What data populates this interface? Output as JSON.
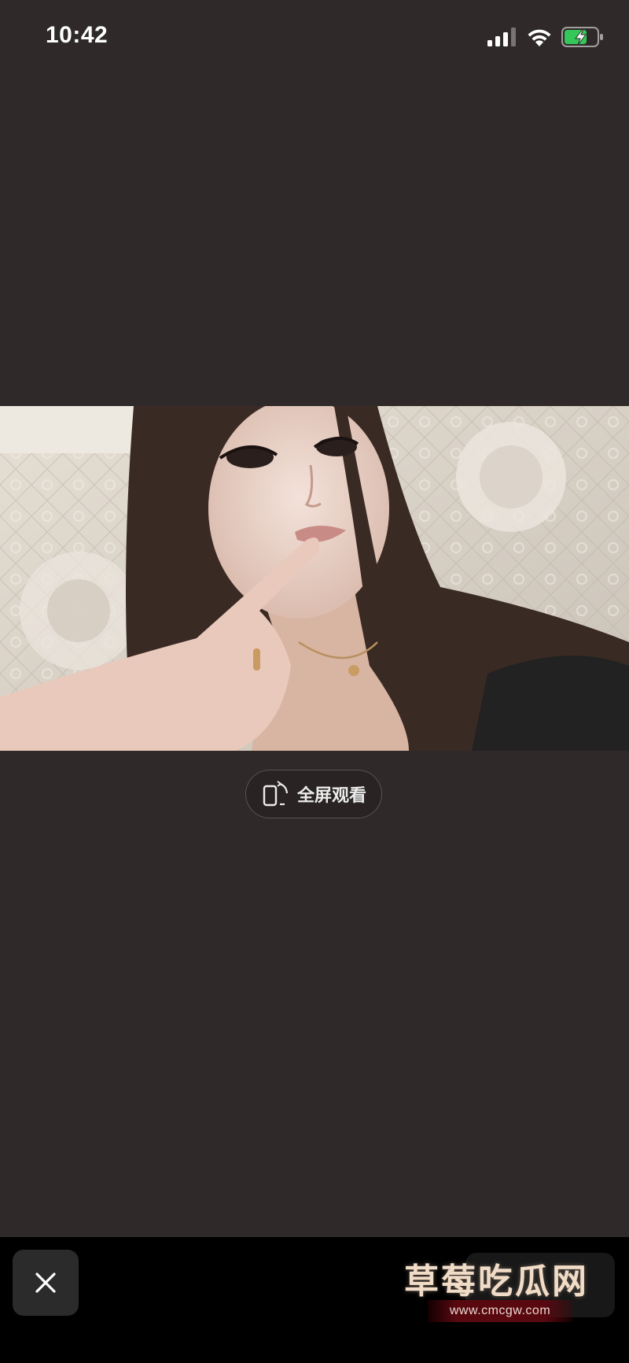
{
  "status_bar": {
    "time": "10:42",
    "signal_icon": "cellular-signal-icon",
    "wifi_icon": "wifi-icon",
    "battery_icon": "battery-charging-icon",
    "battery_color": "#34c759"
  },
  "viewer": {
    "background_color": "#2f2a29",
    "image": {
      "subject": "selfie-photo"
    },
    "fullscreen_button": {
      "label": "全屏观看",
      "icon": "rotate-screen-icon"
    }
  },
  "bottom_bar": {
    "close_icon": "close-icon",
    "watermark": {
      "title": "草莓吃瓜网",
      "url": "www.cmcgw.com"
    }
  }
}
